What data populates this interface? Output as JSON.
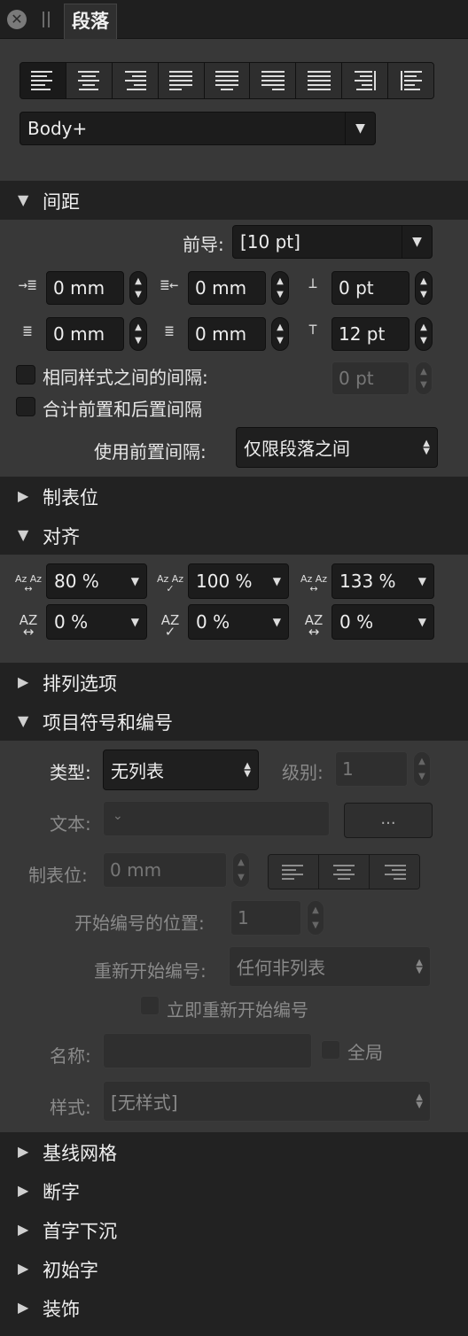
{
  "tab": {
    "title": "段落"
  },
  "alignment_buttons": [
    "align-left",
    "align-center",
    "align-right",
    "justify-left",
    "justify-center",
    "justify-right",
    "justify-all",
    "align-towards-spine",
    "align-away-from-spine"
  ],
  "style_select": {
    "value": "Body+"
  },
  "sections": {
    "spacing": "间距",
    "tabs": "制表位",
    "alignment": "对齐",
    "flow": "排列选项",
    "bullets": "项目符号和编号",
    "baseline": "基线网格",
    "hyphenation": "断字",
    "dropcap": "首字下沉",
    "initial": "初始字",
    "decorations": "装饰"
  },
  "spacing": {
    "leading_label": "前导:",
    "leading_value": "[10 pt]",
    "left_indent": "0 mm",
    "right_indent": "0 mm",
    "space_before": "0 pt",
    "first_line_indent": "0 mm",
    "last_line_indent": "0 mm",
    "space_after": "12 pt",
    "same_style_label": "相同样式之间的间隔:",
    "same_style_value": "0 pt",
    "combine_label": "合计前置和后置间隔",
    "use_before_label": "使用前置间隔:",
    "use_before_value": "仅限段落之间"
  },
  "alignment": {
    "min_word": "80 %",
    "desired_word": "100 %",
    "max_word": "133 %",
    "min_letter": "0 %",
    "desired_letter": "0 %",
    "max_letter": "0 %"
  },
  "bullets": {
    "type_label": "类型:",
    "type_value": "无列表",
    "level_label": "级别:",
    "level_value": "1",
    "text_label": "文本:",
    "text_value": "",
    "more_button": "...",
    "tab_label": "制表位:",
    "tab_value": "0 mm",
    "start_label": "开始编号的位置:",
    "start_value": "1",
    "restart_label": "重新开始编号:",
    "restart_value": "任何非列表",
    "restart_now_label": "立即重新开始编号",
    "name_label": "名称:",
    "name_value": "",
    "global_label": "全局",
    "style_label": "样式:",
    "style_value": "[无样式]"
  }
}
